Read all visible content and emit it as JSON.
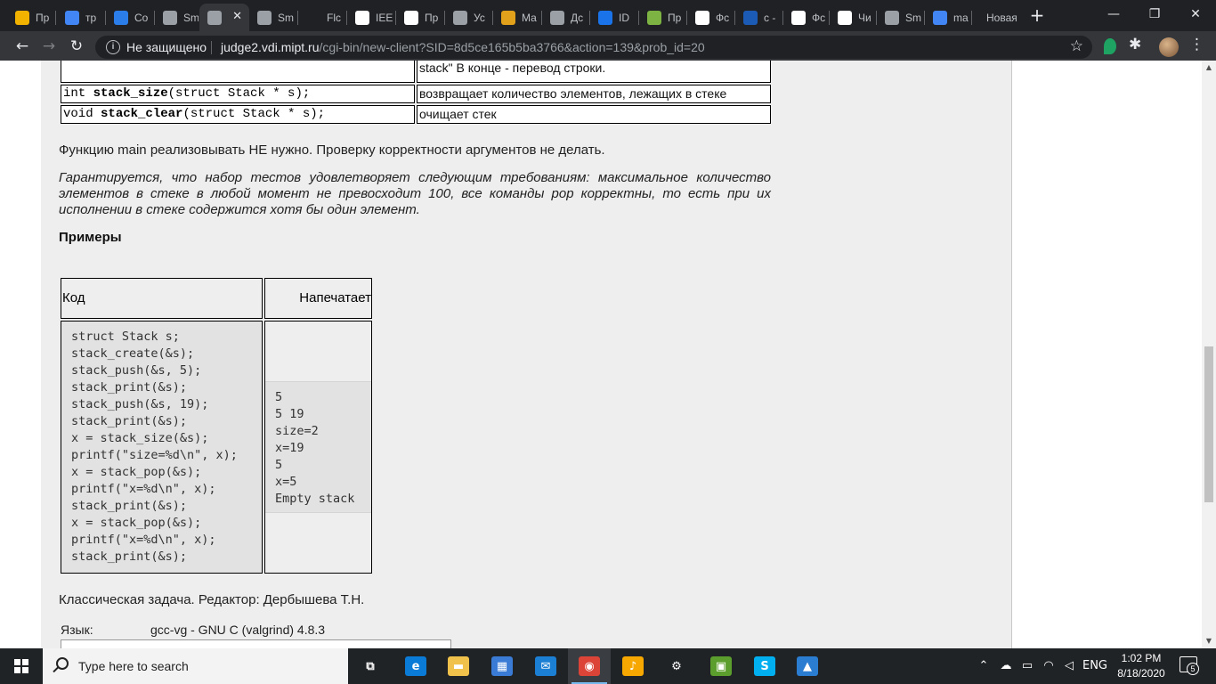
{
  "tabs": [
    {
      "label": "Пр",
      "icon": "yellow-bars-icon",
      "color": "#f2b200"
    },
    {
      "label": "тр",
      "icon": "google-icon",
      "color": "#4285f4"
    },
    {
      "label": "Co",
      "icon": "chat-bubble-icon",
      "color": "#2b7de9"
    },
    {
      "label": "Sm",
      "icon": "globe-icon",
      "color": "#9aa0a6"
    },
    {
      "label": "",
      "icon": "globe-icon",
      "color": "#9aa0a6",
      "active": true
    },
    {
      "label": "Sm",
      "icon": "globe-icon",
      "color": "#9aa0a6"
    },
    {
      "label": "Flc",
      "icon": "blank-icon",
      "color": "#202124"
    },
    {
      "label": "IEE",
      "icon": "wikipedia-icon",
      "color": "#ffffff"
    },
    {
      "label": "Пр",
      "icon": "dp-icon",
      "color": "#ffffff"
    },
    {
      "label": "Ус",
      "icon": "globe-icon",
      "color": "#9aa0a6"
    },
    {
      "label": "Ма",
      "icon": "m-icon",
      "color": "#e2a11a"
    },
    {
      "label": "Дс",
      "icon": "globe-icon",
      "color": "#9aa0a6"
    },
    {
      "label": "ID",
      "icon": "people-icon",
      "color": "#1a73e8"
    },
    {
      "label": "Пр",
      "icon": "book-icon",
      "color": "#7cb342"
    },
    {
      "label": "Фс",
      "icon": "page-icon",
      "color": "#ffffff"
    },
    {
      "label": "с -",
      "icon": "stackoverflow-icon",
      "color": "#1c5bb5"
    },
    {
      "label": "Фс",
      "icon": "page-icon",
      "color": "#ffffff"
    },
    {
      "label": "Чи",
      "icon": "wikipedia-icon",
      "color": "#ffffff"
    },
    {
      "label": "Sm",
      "icon": "globe-icon",
      "color": "#9aa0a6"
    },
    {
      "label": "ma",
      "icon": "google-icon",
      "color": "#4285f4"
    },
    {
      "label": "Новая",
      "icon": "",
      "color": ""
    }
  ],
  "addressbar": {
    "security_text": "Не защищено",
    "url_domain": "judge2.vdi.mipt.ru",
    "url_path": "/cgi-bin/new-client?SID=8d5ce165b5ba3766&action=139&prob_id=20"
  },
  "functions": [
    {
      "sig_prefix": "",
      "sig_name": "",
      "sig_suffix": "",
      "desc_lines": [
        "",
        "stack\" В конце - перевод строки."
      ]
    },
    {
      "sig_prefix": "int ",
      "sig_name": "stack_size",
      "sig_suffix": "(struct Stack * s);",
      "desc": "возвращает количество элементов, лежащих в стеке"
    },
    {
      "sig_prefix": "void ",
      "sig_name": "stack_clear",
      "sig_suffix": "(struct Stack * s);",
      "desc": "очищает стек"
    }
  ],
  "paragraphs": {
    "main": "Функцию main реализовывать НЕ нужно. Проверку корректности аргументов не делать.",
    "guarantee": "Гарантируется, что набор тестов удовлетворяет следующим требованиям: максимальное количество элементов в стеке в любой момент не превосходит 100, все команды pop корректны, то есть при их исполнении в стеке содержится хотя бы один элемент.",
    "examples_title": "Примеры",
    "classic": "Классическая задача. Редактор: Дербышева Т.Н."
  },
  "example": {
    "header_code": "Код",
    "header_output": "Напечатает",
    "code_lines": [
      "struct Stack s;",
      "stack_create(&s);",
      "stack_push(&s, 5);",
      "stack_print(&s);",
      "stack_push(&s, 19);",
      "stack_print(&s);",
      "x = stack_size(&s);",
      "printf(\"size=%d\\n\", x);",
      "x = stack_pop(&s);",
      "printf(\"x=%d\\n\", x);",
      "stack_print(&s);",
      "x = stack_pop(&s);",
      "printf(\"x=%d\\n\", x);",
      "stack_print(&s);"
    ],
    "output_lines": [
      "5",
      "5 19",
      "size=2",
      "x=19",
      "5",
      "x=5",
      "Empty stack"
    ]
  },
  "language": {
    "label": "Язык:",
    "value": "gcc-vg - GNU C (valgrind) 4.8.3"
  },
  "taskbar": {
    "search_placeholder": "Type here to search",
    "apps": [
      {
        "name": "task-view-icon",
        "glyph": "⧉",
        "color": "#202326"
      },
      {
        "name": "edge-icon",
        "glyph": "e",
        "color": "#0a7bd6"
      },
      {
        "name": "file-explorer-icon",
        "glyph": "▬",
        "color": "#f0c24b"
      },
      {
        "name": "store-icon",
        "glyph": "▦",
        "color": "#3a7bd5"
      },
      {
        "name": "mail-icon",
        "glyph": "✉",
        "color": "#1b7fd3"
      },
      {
        "name": "chrome-icon",
        "glyph": "◉",
        "color": "#db4437",
        "running": true,
        "active": true
      },
      {
        "name": "yandex-music-icon",
        "glyph": "♪",
        "color": "#f6a800"
      },
      {
        "name": "settings-icon",
        "glyph": "⚙",
        "color": "#202326"
      },
      {
        "name": "office-icon",
        "glyph": "▣",
        "color": "#5c9e2e"
      },
      {
        "name": "skype-icon",
        "glyph": "S",
        "color": "#00aff0"
      },
      {
        "name": "photos-icon",
        "glyph": "▲",
        "color": "#2a7dd1"
      }
    ],
    "lang": "ENG",
    "time": "1:02 PM",
    "date": "8/18/2020",
    "notifications": "5"
  }
}
